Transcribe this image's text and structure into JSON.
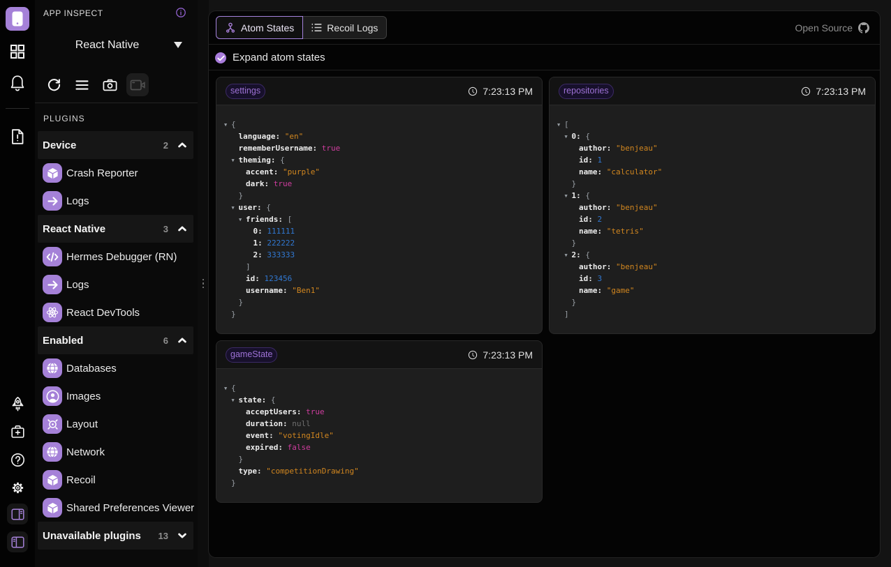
{
  "colors": {
    "accent_purple": "#a581d8",
    "tag_text": "#9e72d6",
    "json_string": "#d1861f",
    "json_number": "#3178d2",
    "json_boolean": "#cf3d9f",
    "json_null": "#6f6f6f",
    "card_body_bg": "#1e1e1e",
    "card_header_bg": "#131313",
    "panel_bg": "#040404"
  },
  "rail": {
    "icons": [
      "app-phone-icon",
      "apps-grid-icon",
      "bell-icon",
      "file-exclamation-icon",
      "rocket-icon",
      "doctor-bag-icon",
      "question-circle-icon",
      "gear-icon",
      "panel-right-icon",
      "panel-left-icon"
    ]
  },
  "sidebar": {
    "title": "APP INSPECT",
    "info_icon": "info-circle-icon",
    "app_selector": {
      "value": "React Native",
      "icon": "caret-down-icon"
    },
    "toolbar_icons": [
      "refresh-icon",
      "menu-icon",
      "camera-icon",
      "video-camera-icon"
    ],
    "plugins_label": "PLUGINS",
    "groups": [
      {
        "label": "Device",
        "count": "2",
        "expanded": true,
        "items": [
          {
            "icon": "cube-icon",
            "label": "Crash Reporter"
          },
          {
            "icon": "arrow-right-icon",
            "label": "Logs"
          }
        ]
      },
      {
        "label": "React Native",
        "count": "3",
        "expanded": true,
        "items": [
          {
            "icon": "code-icon",
            "label": "Hermes Debugger (RN)"
          },
          {
            "icon": "arrow-right-icon",
            "label": "Logs"
          },
          {
            "icon": "react-icon",
            "label": "React DevTools"
          }
        ]
      },
      {
        "label": "Enabled",
        "count": "6",
        "expanded": true,
        "items": [
          {
            "icon": "globe-icon",
            "label": "Databases"
          },
          {
            "icon": "user-circle-icon",
            "label": "Images"
          },
          {
            "icon": "target-icon",
            "label": "Layout"
          },
          {
            "icon": "globe-icon",
            "label": "Network"
          },
          {
            "icon": "cube-icon",
            "label": "Recoil"
          },
          {
            "icon": "cube-icon",
            "label": "Shared Preferences Viewer"
          }
        ]
      },
      {
        "label": "Unavailable plugins",
        "count": "13",
        "expanded": false,
        "items": []
      }
    ]
  },
  "main": {
    "tabs": [
      {
        "label": "Atom States",
        "icon": "atom-icon",
        "active": true
      },
      {
        "label": "Recoil Logs",
        "icon": "list-icon",
        "active": false
      }
    ],
    "open_source": {
      "label": "Open Source",
      "icon": "github-icon"
    },
    "checkbox": {
      "label": "Expand atom states",
      "checked": true
    },
    "cards": [
      {
        "tag": "settings",
        "time": "7:23:13 PM",
        "column": 0,
        "value": {
          "language": "en",
          "rememberUsername": true,
          "theming": {
            "accent": "purple",
            "dark": true
          },
          "user": {
            "friends": [
              111111,
              222222,
              333333
            ],
            "id": 123456,
            "username": "Ben1"
          }
        }
      },
      {
        "tag": "repositories",
        "time": "7:23:13 PM",
        "column": 1,
        "value": [
          {
            "author": "benjeau",
            "id": 1,
            "name": "calculator"
          },
          {
            "author": "benjeau",
            "id": 2,
            "name": "tetris"
          },
          {
            "author": "benjeau",
            "id": 3,
            "name": "game"
          }
        ]
      },
      {
        "tag": "gameState",
        "time": "7:23:13 PM",
        "column": 0,
        "value": {
          "state": {
            "acceptUsers": true,
            "duration": null,
            "event": "votingIdle",
            "expired": false
          },
          "type": "competitionDrawing"
        }
      }
    ]
  }
}
